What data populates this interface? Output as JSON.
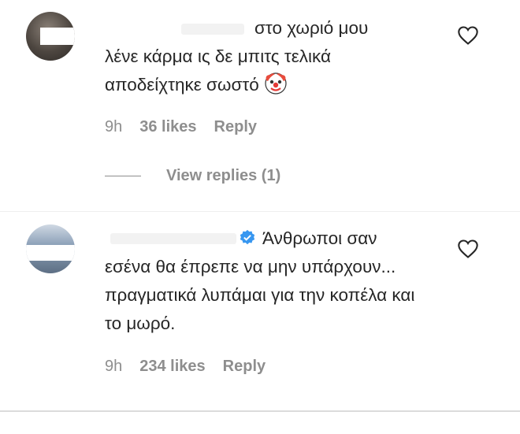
{
  "comments": [
    {
      "text_line1": "στο χωριό μου",
      "text_rest": "λένε κάρμα ις δε μπιτς τελικά αποδείχτηκε σωστό",
      "time": "9h",
      "likes": "36 likes",
      "reply": "Reply",
      "view_replies": "View replies (1)"
    },
    {
      "text_line1": "Άνθρωποι σαν",
      "text_rest": "εσένα θα έπρεπε να μην υπάρχουν... πραγματικά λυπάμαι για την κοπέλα και το μωρό.",
      "time": "9h",
      "likes": "234 likes",
      "reply": "Reply"
    }
  ],
  "icons": {
    "like": "heart-outline-icon",
    "emoji": "clown-face-emoji",
    "verified": "verified-badge-icon"
  },
  "colors": {
    "text": "#262626",
    "meta": "#8e8e8e",
    "verified": "#3897f0"
  }
}
